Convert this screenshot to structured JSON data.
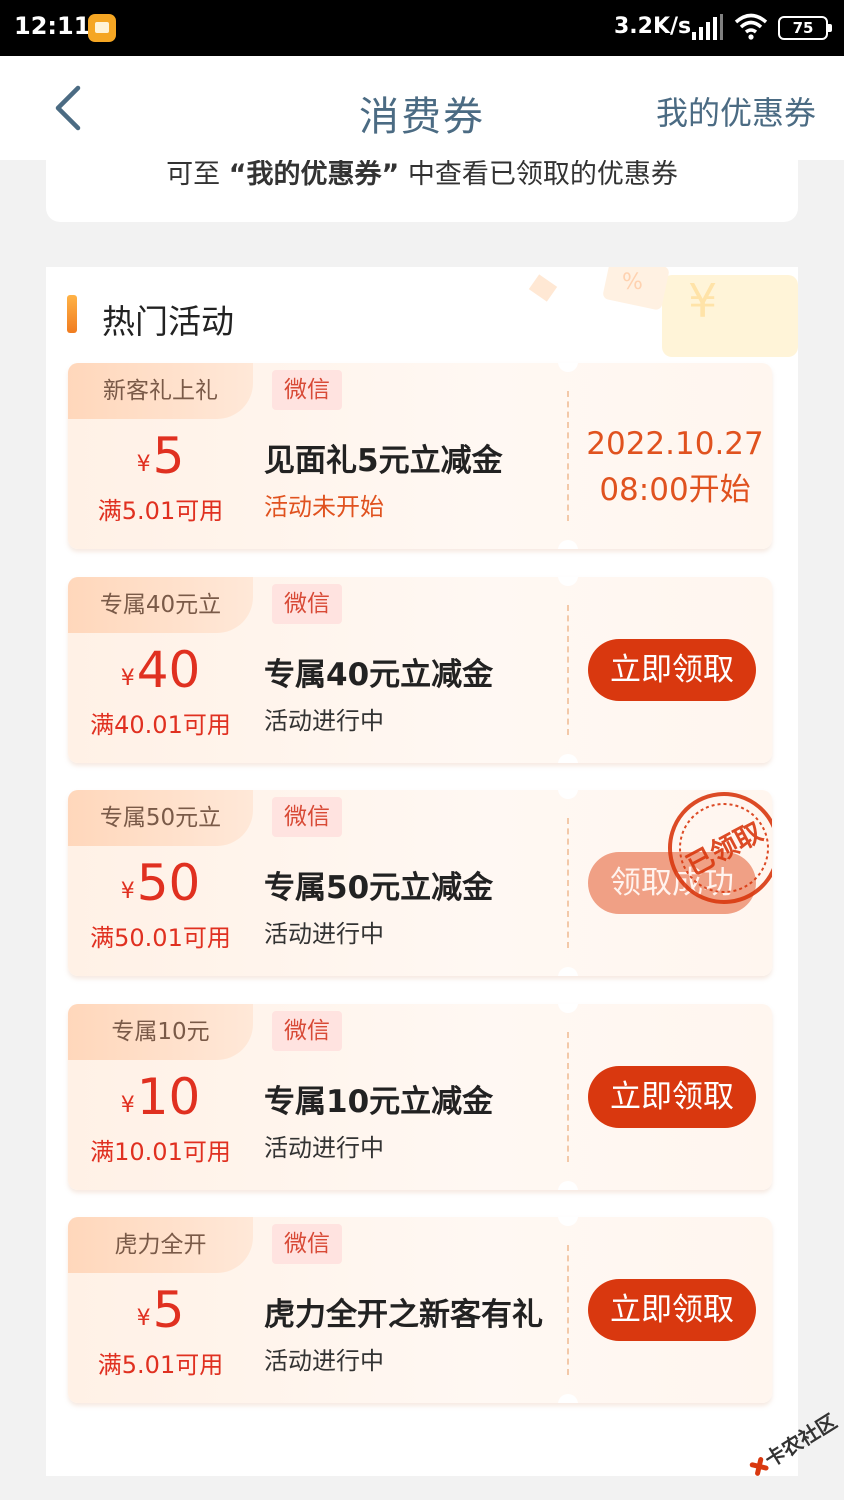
{
  "status_bar": {
    "time": "12:11",
    "network_speed": "3.2K/s",
    "battery": "75"
  },
  "header": {
    "title": "消费券",
    "my_coupons_link": "我的优惠券"
  },
  "info": {
    "prefix": "可至",
    "highlight": "“我的优惠券”",
    "suffix": "中查看已领取的优惠券"
  },
  "hot": {
    "title": "热门活动"
  },
  "coupons": [
    {
      "tag": "新客礼上礼",
      "currency": "¥",
      "amount": "5",
      "condition": "满5.01可用",
      "channel": "微信",
      "name": "见面礼5元立减金",
      "status": "活动未开始",
      "start_date": "2022.10.27",
      "start_time": "08:00开始"
    },
    {
      "tag": "专属40元立",
      "currency": "¥",
      "amount": "40",
      "condition": "满40.01可用",
      "channel": "微信",
      "name": "专属40元立减金",
      "status": "活动进行中",
      "button": "立即领取"
    },
    {
      "tag": "专属50元立",
      "currency": "¥",
      "amount": "50",
      "condition": "满50.01可用",
      "channel": "微信",
      "name": "专属50元立减金",
      "status": "活动进行中",
      "button": "领取成功",
      "stamp": "已领取"
    },
    {
      "tag": "专属10元",
      "currency": "¥",
      "amount": "10",
      "condition": "满10.01可用",
      "channel": "微信",
      "name": "专属10元立减金",
      "status": "活动进行中",
      "button": "立即领取"
    },
    {
      "tag": "虎力全开",
      "currency": "¥",
      "amount": "5",
      "condition": "满5.01可用",
      "channel": "微信",
      "name": "虎力全开之新客有礼",
      "status": "活动进行中",
      "button": "立即领取"
    }
  ],
  "watermark": "卡农社区",
  "colors": {
    "accent": "#d9380f",
    "price": "#e03020",
    "header_text": "#4b6b83"
  }
}
